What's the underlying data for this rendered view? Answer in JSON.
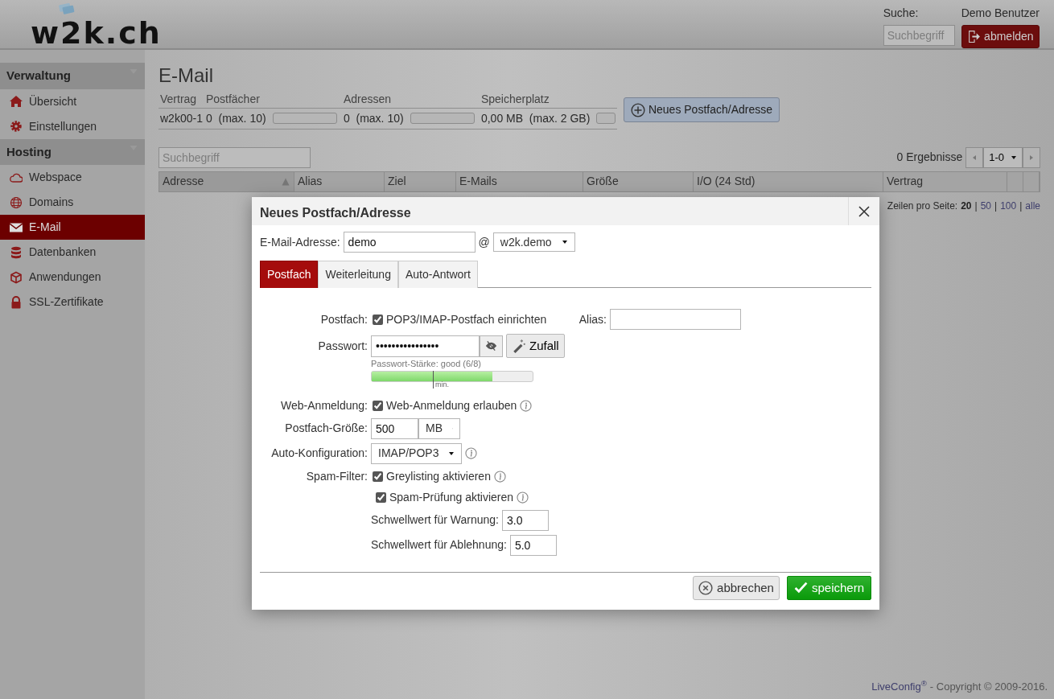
{
  "header": {
    "logo": "w2k.ch",
    "search": {
      "label": "Suche:",
      "placeholder": "Suchbegriff"
    },
    "user": "Demo Benutzer",
    "logout": "abmelden"
  },
  "sidebar": {
    "sections": [
      {
        "title": "Verwaltung",
        "items": [
          {
            "label": "Übersicht",
            "selected": false
          },
          {
            "label": "Einstellungen",
            "selected": false
          }
        ]
      },
      {
        "title": "Hosting",
        "items": [
          {
            "label": "Webspace",
            "selected": false
          },
          {
            "label": "Domains",
            "selected": false
          },
          {
            "label": "E-Mail",
            "selected": true
          },
          {
            "label": "Datenbanken",
            "selected": false
          },
          {
            "label": "Anwendungen",
            "selected": false
          },
          {
            "label": "SSL-Zertifikate",
            "selected": false
          }
        ]
      }
    ]
  },
  "page": {
    "title": "E-Mail",
    "usage": {
      "contract_label": "Vertrag",
      "contract": "w2k00-1",
      "meters": [
        {
          "label": "Postfächer",
          "value": "0",
          "max": "(max. 10)",
          "level": 0
        },
        {
          "label": "Adressen",
          "value": "0",
          "max": "(max. 10)",
          "level": 0
        },
        {
          "label": "Speicherplatz",
          "value": "0,00 MB",
          "max": "(max. 2 GB)",
          "level": 0
        }
      ]
    },
    "new_button": "Neues Postfach/Adresse",
    "search": {
      "placeholder": "Suchbegriff"
    },
    "results": "0 Ergebnisse",
    "pager": "1-0",
    "table": {
      "columns": [
        {
          "label": "Adresse",
          "sorted": true
        },
        {
          "label": "Alias"
        },
        {
          "label": "Ziel"
        },
        {
          "label": "E-Mails"
        },
        {
          "label": "Größe"
        },
        {
          "label": "I/O (24 Std)"
        },
        {
          "label": "Vertrag"
        },
        {},
        {}
      ]
    },
    "page_size": {
      "label": "Zeilen pro Seite:",
      "separator": "|",
      "options": [
        {
          "label": "20",
          "selected": true
        },
        {
          "label": "50",
          "selected": false
        },
        {
          "label": "100",
          "selected": false
        },
        {
          "label": "alle",
          "selected": false
        }
      ]
    }
  },
  "dialog": {
    "title": "Neues Postfach/Adresse",
    "address": {
      "label": "E-Mail-Adresse:",
      "value": "demo",
      "at": "@",
      "domain": "w2k.demo"
    },
    "tabs": [
      {
        "label": "Postfach",
        "selected": true
      },
      {
        "label": "Weiterleitung",
        "selected": false
      },
      {
        "label": "Auto-Antwort",
        "selected": false
      }
    ],
    "mailbox": {
      "label": "Postfach:",
      "option": "POP3/IMAP-Postfach einrichten",
      "checked": true
    },
    "alias": {
      "label": "Alias:"
    },
    "password": {
      "label": "Passwort:",
      "value": "••••••••••••••••",
      "random": "Zufall",
      "strength": "Passwort-Stärke: good (6/8)",
      "level": 0.75,
      "min": "min."
    },
    "web_login": {
      "label": "Web-Anmeldung:",
      "option": "Web-Anmeldung erlauben",
      "checked": true,
      "info": true
    },
    "size": {
      "label": "Postfach-Größe:",
      "value": "500",
      "unit": "MB"
    },
    "autoconfig": {
      "label": "Auto-Konfiguration:",
      "value": "IMAP/POP3",
      "info": true
    },
    "spam": {
      "label": "Spam-Filter:",
      "options": [
        {
          "label": "Greylisting aktivieren",
          "checked": true,
          "info": true
        },
        {
          "label": "Spam-Prüfung aktivieren",
          "checked": true,
          "info": true
        }
      ]
    },
    "thresholds": [
      {
        "label": "Schwellwert für Warnung:",
        "value": "3.0"
      },
      {
        "label": "Schwellwert für Ablehnung:",
        "value": "5.0"
      }
    ],
    "cancel": "abbrechen",
    "save": "speichern"
  },
  "footer": {
    "brand": "LiveConfig$^{®}$",
    "copyright": "- Copyright © 2009-2016."
  }
}
